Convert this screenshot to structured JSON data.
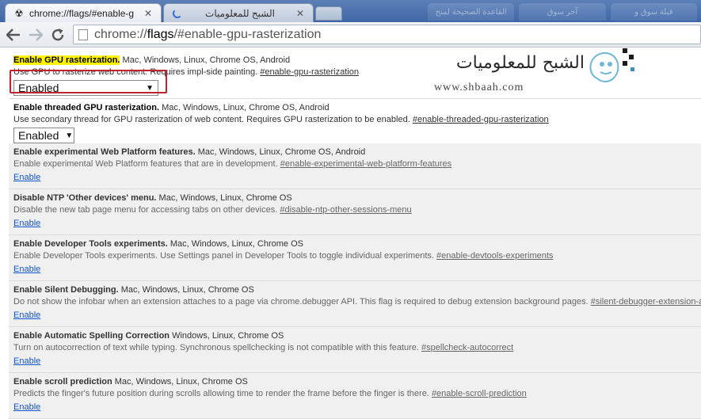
{
  "tabs": [
    {
      "title": "chrome://flags/#enable-g",
      "icon": "flags-icon",
      "active": true
    },
    {
      "title": "الشبح للمعلوميات",
      "icon": "loading-spinner-icon",
      "active": false
    }
  ],
  "background_tabs": [
    "قبلة سوق و",
    "آخر سوق",
    "القاعدة الصحيحة لمنح"
  ],
  "toolbar": {
    "url_scheme": "chrome://",
    "url_host": "flags",
    "url_path": "/#enable-gpu-rasterization"
  },
  "watermark": {
    "arabic": "الشبح للمعلوميات",
    "english": "www.shbaah.com"
  },
  "experiments": [
    {
      "name": "Enable GPU rasterization.",
      "platforms": "Mac, Windows, Linux, Chrome OS, Android",
      "description": "Use GPU to rasterize web content. Requires impl-side painting.",
      "link": "#enable-gpu-rasterization",
      "control": "select",
      "value": "Enabled",
      "highlighted": true
    },
    {
      "name": "Enable threaded GPU rasterization.",
      "platforms": "Mac, Windows, Linux, Chrome OS, Android",
      "description": "Use secondary thread for GPU rasterization of web content. Requires GPU rasterization to be enabled.",
      "link": "#enable-threaded-gpu-rasterization",
      "control": "select",
      "value": "Enabled"
    },
    {
      "name": "Enable experimental Web Platform features.",
      "platforms": "Mac, Windows, Linux, Chrome OS, Android",
      "description": "Enable experimental Web Platform features that are in development.",
      "link": "#enable-experimental-web-platform-features",
      "control": "link",
      "value": "Enable"
    },
    {
      "name": "Disable NTP 'Other devices' menu.",
      "platforms": "Mac, Windows, Linux, Chrome OS",
      "description": "Disable the new tab page menu for accessing tabs on other devices.",
      "link": "#disable-ntp-other-sessions-menu",
      "control": "link",
      "value": "Enable"
    },
    {
      "name": "Enable Developer Tools experiments.",
      "platforms": "Mac, Windows, Linux, Chrome OS",
      "description": "Enable Developer Tools experiments. Use Settings panel in Developer Tools to toggle individual experiments.",
      "link": "#enable-devtools-experiments",
      "control": "link",
      "value": "Enable"
    },
    {
      "name": "Enable Silent Debugging.",
      "platforms": "Mac, Windows, Linux, Chrome OS",
      "description": "Do not show the infobar when an extension attaches to a page via chrome.debugger API. This flag is required to debug extension background pages.",
      "link": "#silent-debugger-extension-api",
      "control": "link",
      "value": "Enable"
    },
    {
      "name": "Enable Automatic Spelling Correction",
      "platforms": "Windows, Linux, Chrome OS",
      "description": "Turn on autocorrection of text while typing. Synchronous spellchecking is not compatible with this feature.",
      "link": "#spellcheck-autocorrect",
      "control": "link",
      "value": "Enable"
    },
    {
      "name": "Enable scroll prediction",
      "platforms": "Mac, Windows, Linux, Chrome OS",
      "description": "Predicts the finger's future position during scrolls allowing time to render the frame before the finger is there.",
      "link": "#enable-scroll-prediction",
      "control": "link",
      "value": "Enable"
    }
  ]
}
